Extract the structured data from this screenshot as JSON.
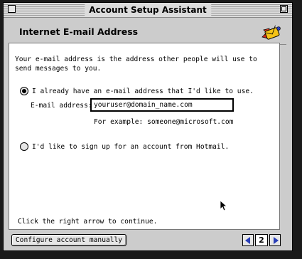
{
  "window": {
    "title": "Account Setup Assistant"
  },
  "header": {
    "title": "Internet E-mail Address",
    "icon": "rocket-mail-icon"
  },
  "content": {
    "intro": "Your e-mail address is the address other people will use to send messages to you.",
    "option_have": "I already have an e-mail address that I'd like to use.",
    "email_label": "E-mail address:",
    "email_value": "youruser@domain_name.com",
    "example": "For example: someone@microsoft.com",
    "option_hotmail": "I'd like to sign up for an account from Hotmail.",
    "continue_hint": "Click the right arrow to continue."
  },
  "footer": {
    "configure_label": "Configure account manually",
    "page_number": "2"
  },
  "colors": {
    "nav_arrow": "#2a3fb8",
    "window_bg": "#cccccc",
    "desktop": "#1a1a1a"
  }
}
